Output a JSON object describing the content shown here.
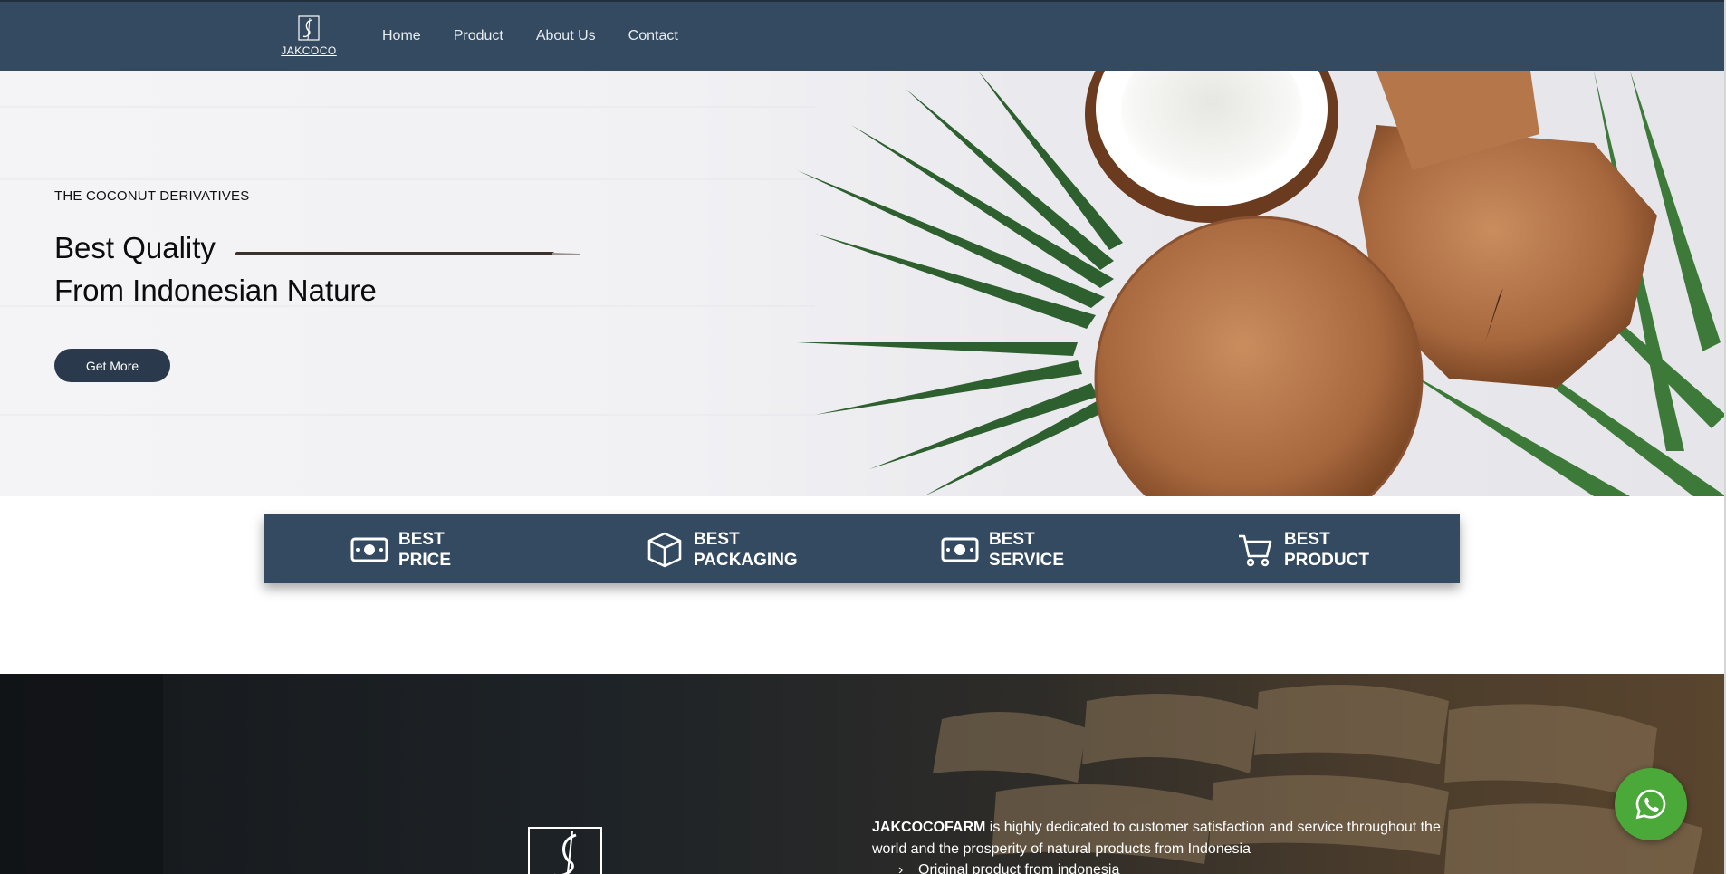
{
  "nav": {
    "logo_text": "JAKCOCO",
    "links": [
      "Home",
      "Product",
      "About Us",
      "Contact"
    ]
  },
  "hero": {
    "eyebrow": "THE COCONUT DERIVATIVES",
    "title_line1": "Best Quality",
    "title_line2": "From Indonesian Nature",
    "button_label": "Get More"
  },
  "features": [
    {
      "icon": "money-bill-icon",
      "line1": "BEST",
      "line2": "PRICE"
    },
    {
      "icon": "box-icon",
      "line1": "BEST",
      "line2": "PACKAGING"
    },
    {
      "icon": "money-bill-icon",
      "line1": "BEST",
      "line2": "SERVICE"
    },
    {
      "icon": "cart-icon",
      "line1": "BEST",
      "line2": "PRODUCT"
    }
  ],
  "about": {
    "brand": "JAKCOCOFARM",
    "description": " is highly dedicated to customer satisfaction and service throughout the world and the prosperity of natural products from Indonesia",
    "bullets": [
      "Original product from indonesia"
    ]
  },
  "colors": {
    "navbar": "#344a60",
    "button": "#2a3a4c",
    "whatsapp": "#4aa938"
  }
}
